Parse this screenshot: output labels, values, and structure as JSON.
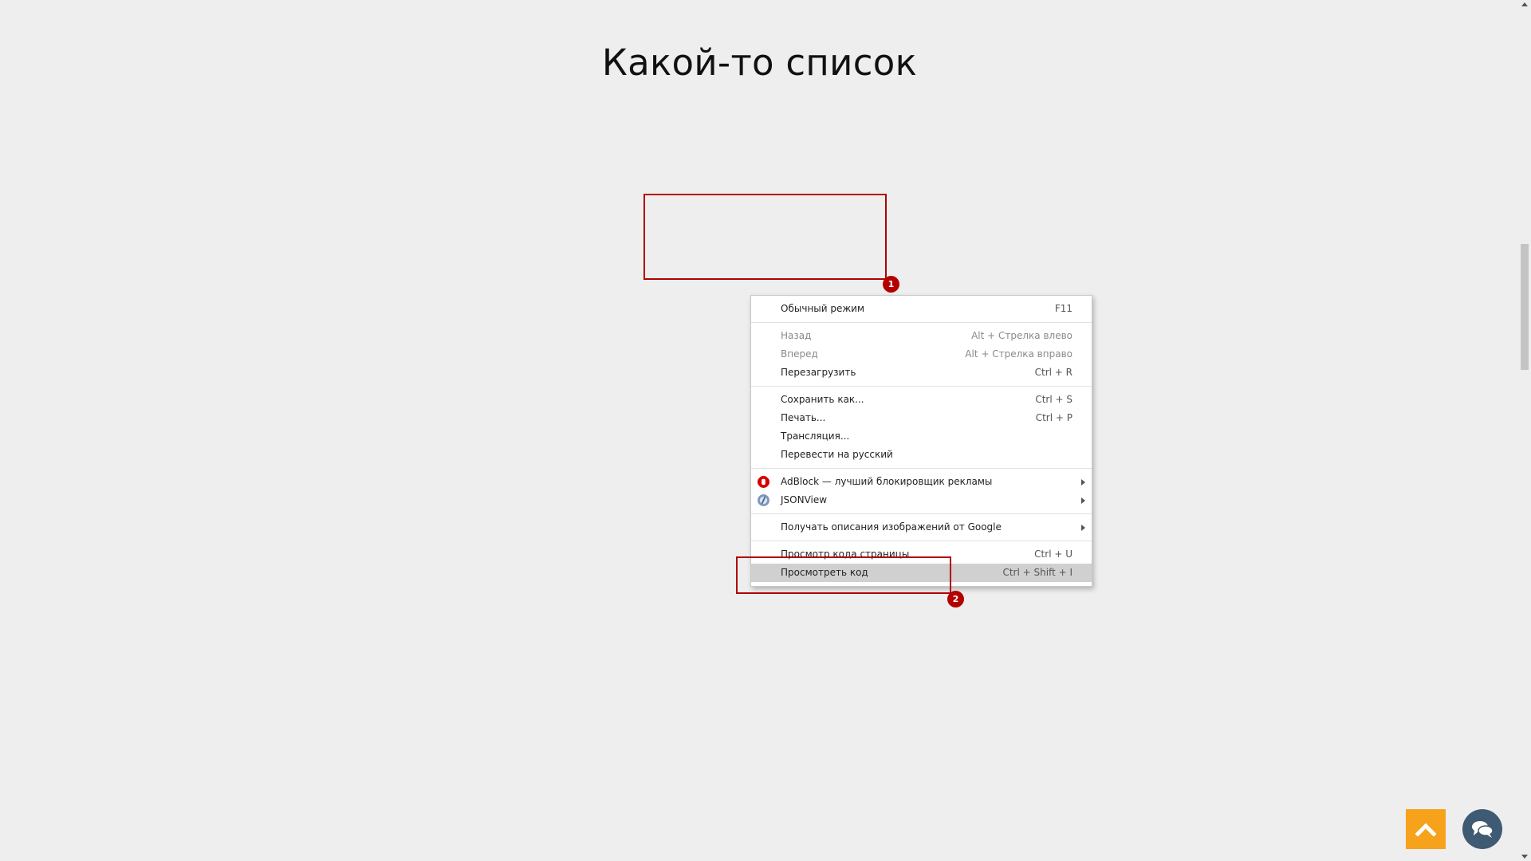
{
  "page": {
    "title": "Какой-то список"
  },
  "annotations": [
    {
      "badge": "1"
    },
    {
      "badge": "2"
    }
  ],
  "context_menu": {
    "groups": [
      [
        {
          "label": "Обычный режим",
          "shortcut": "F11",
          "disabled": false
        }
      ],
      [
        {
          "label": "Назад",
          "shortcut": "Alt + Стрелка влево",
          "disabled": true
        },
        {
          "label": "Вперед",
          "shortcut": "Alt + Стрелка вправо",
          "disabled": true
        },
        {
          "label": "Перезагрузить",
          "shortcut": "Ctrl + R",
          "disabled": false
        }
      ],
      [
        {
          "label": "Сохранить как...",
          "shortcut": "Ctrl + S",
          "disabled": false
        },
        {
          "label": "Печать...",
          "shortcut": "Ctrl + P",
          "disabled": false
        },
        {
          "label": "Трансляция...",
          "shortcut": "",
          "disabled": false
        },
        {
          "label": "Перевести на русский",
          "shortcut": "",
          "disabled": false
        }
      ],
      [
        {
          "label": "AdBlock — лучший блокировщик рекламы",
          "icon": "adblock-icon",
          "submenu": true
        },
        {
          "label": "JSONView",
          "icon": "jsonview-icon",
          "submenu": true
        }
      ],
      [
        {
          "label": "Получать описания изображений от Google",
          "submenu": true
        }
      ],
      [
        {
          "label": "Просмотр кода страницы",
          "shortcut": "Ctrl + U",
          "disabled": false
        },
        {
          "label": "Просмотреть код",
          "shortcut": "Ctrl + Shift + I",
          "highlighted": true
        }
      ]
    ]
  },
  "colors": {
    "background": "#eeeeee",
    "annotation_red": "#b20000",
    "scroll_top_button": "#f7a21b",
    "chat_button": "#3f5a73"
  },
  "icons": {
    "scroll_top": "chevron-up-icon",
    "chat": "chat-bubbles-icon"
  }
}
